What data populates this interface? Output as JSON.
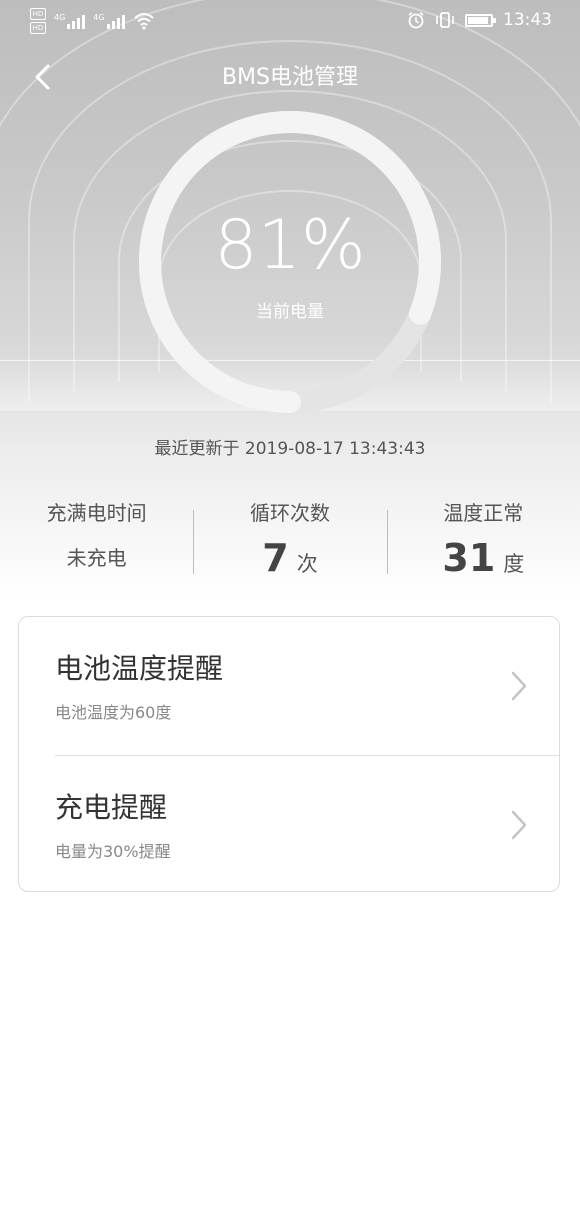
{
  "status_bar": {
    "network_1": "4G",
    "network_2": "4G",
    "time": "13:43",
    "icons": [
      "hd-icon",
      "signal-icon",
      "wifi-icon",
      "alarm-icon",
      "vibrate-icon",
      "battery-icon"
    ]
  },
  "nav": {
    "title": "BMS电池管理",
    "back_icon": "back-arrow-icon"
  },
  "battery": {
    "percent_text": "81%",
    "level": 0.81,
    "label": "当前电量"
  },
  "updated": "最近更新于 2019-08-17 13:43:43",
  "stats": [
    {
      "label": "充满电时间",
      "value": "未充电",
      "unit": ""
    },
    {
      "label": "循环次数",
      "value": "7",
      "unit": "次"
    },
    {
      "label": "温度正常",
      "value": "31",
      "unit": "度"
    }
  ],
  "reminders": [
    {
      "title": "电池温度提醒",
      "subtitle": "电池温度为60度"
    },
    {
      "title": "充电提醒",
      "subtitle": "电量为30%提醒"
    }
  ],
  "colors": {
    "ring_track": "#e4e4e4",
    "ring_fill": "#f4f4f4",
    "text_dark": "#333333"
  }
}
